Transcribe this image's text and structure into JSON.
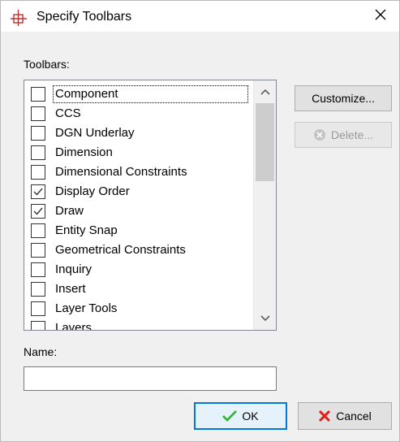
{
  "window": {
    "title": "Specify Toolbars",
    "app_icon": "target-icon",
    "close_icon": "close-icon"
  },
  "toolbars_label": "Toolbars:",
  "toolbars_list": {
    "items": [
      {
        "label": "Component",
        "checked": false
      },
      {
        "label": "CCS",
        "checked": false
      },
      {
        "label": "DGN Underlay",
        "checked": false
      },
      {
        "label": "Dimension",
        "checked": false
      },
      {
        "label": "Dimensional Constraints",
        "checked": false
      },
      {
        "label": "Display Order",
        "checked": true
      },
      {
        "label": "Draw",
        "checked": true
      },
      {
        "label": "Entity Snap",
        "checked": false
      },
      {
        "label": "Geometrical Constraints",
        "checked": false
      },
      {
        "label": "Inquiry",
        "checked": false
      },
      {
        "label": "Insert",
        "checked": false
      },
      {
        "label": "Layer Tools",
        "checked": false
      },
      {
        "label": "Layers",
        "checked": false
      }
    ],
    "focused_index": 0
  },
  "buttons": {
    "customize": "Customize...",
    "delete": "Delete...",
    "ok": "OK",
    "cancel": "Cancel"
  },
  "name_label": "Name:",
  "name_value": "",
  "colors": {
    "accent": "#0078d7",
    "ok_check": "#2bb52b",
    "cancel_x": "#e0201a",
    "app_icon": "#c0302e"
  }
}
